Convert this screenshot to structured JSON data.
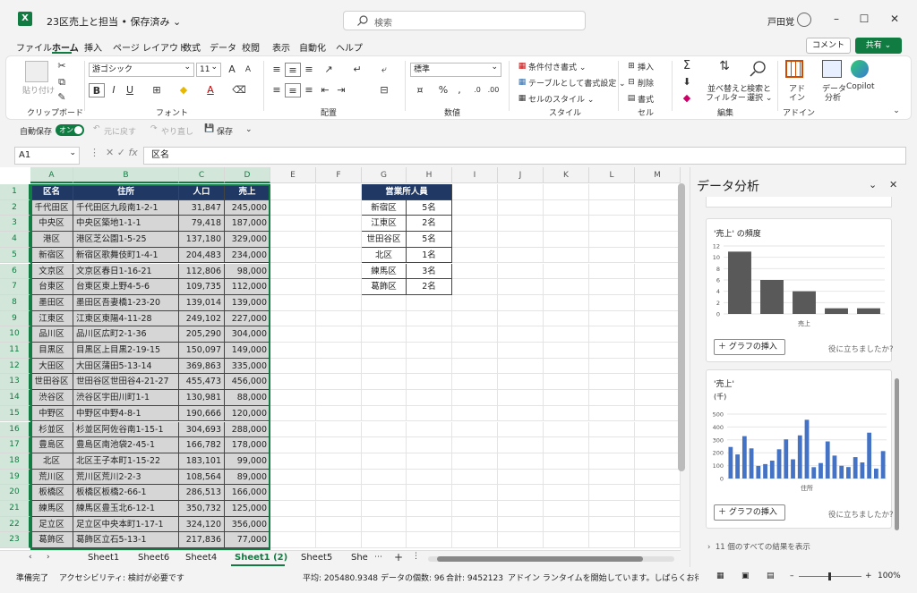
{
  "app": {
    "logo_letter": "X",
    "doc_title": "23区売上と担当 • 保存済み ⌄",
    "search_placeholder": "検索",
    "user_name": "戸田覚",
    "comment_label": "コメント",
    "share_label": "共有 ⌄"
  },
  "menu": [
    "ファイル",
    "ホーム",
    "挿入",
    "ページ レイアウト",
    "数式",
    "データ",
    "校閲",
    "表示",
    "自動化",
    "ヘルプ"
  ],
  "ribbon": {
    "paste": "貼り付け",
    "font_name": "游ゴシック",
    "font_size": "11",
    "number_format": "標準",
    "conditional": "条件付き書式 ⌄",
    "table_format": "テーブルとして書式設定 ⌄",
    "cell_style": "セルのスタイル ⌄",
    "insert": "挿入",
    "delete": "削除",
    "format": "書式",
    "sort_filter_1": "並べ替えと",
    "sort_filter_2": "フィルター ⌄",
    "find_1": "検索と",
    "find_2": "選択 ⌄",
    "addin_1": "アド",
    "addin_2": "イン",
    "analyze_1": "データ",
    "analyze_2": "分析",
    "copilot": "Copilot",
    "groups": [
      "クリップボード",
      "フォント",
      "配置",
      "数値",
      "スタイル",
      "セル",
      "編集",
      "アドイン"
    ]
  },
  "qat": {
    "autosave": "自動保存",
    "toggle": "オン",
    "undo": "元に戻す",
    "redo": "やり直し",
    "save": "保存"
  },
  "formula": {
    "namebox": "A1",
    "content": "区名"
  },
  "columns": [
    "A",
    "B",
    "C",
    "D",
    "E",
    "F",
    "G",
    "H",
    "I",
    "J",
    "K",
    "L",
    "M"
  ],
  "table": {
    "headers": [
      "区名",
      "住所",
      "人口",
      "売上"
    ],
    "rows": [
      [
        "千代田区",
        "千代田区九段南1-2-1",
        "31,847",
        "245,000"
      ],
      [
        "中央区",
        "中央区築地1-1-1",
        "79,418",
        "187,000"
      ],
      [
        "港区",
        "港区芝公園1-5-25",
        "137,180",
        "329,000"
      ],
      [
        "新宿区",
        "新宿区歌舞伎町1-4-1",
        "204,483",
        "234,000"
      ],
      [
        "文京区",
        "文京区春日1-16-21",
        "112,806",
        "98,000"
      ],
      [
        "台東区",
        "台東区東上野4-5-6",
        "109,735",
        "112,000"
      ],
      [
        "墨田区",
        "墨田区吾妻橋1-23-20",
        "139,014",
        "139,000"
      ],
      [
        "江東区",
        "江東区東陽4-11-28",
        "249,102",
        "227,000"
      ],
      [
        "品川区",
        "品川区広町2-1-36",
        "205,290",
        "304,000"
      ],
      [
        "目黒区",
        "目黒区上目黒2-19-15",
        "150,097",
        "149,000"
      ],
      [
        "大田区",
        "大田区蒲田5-13-14",
        "369,863",
        "335,000"
      ],
      [
        "世田谷区",
        "世田谷区世田谷4-21-27",
        "455,473",
        "456,000"
      ],
      [
        "渋谷区",
        "渋谷区宇田川町1-1",
        "130,981",
        "88,000"
      ],
      [
        "中野区",
        "中野区中野4-8-1",
        "190,666",
        "120,000"
      ],
      [
        "杉並区",
        "杉並区阿佐谷南1-15-1",
        "304,693",
        "288,000"
      ],
      [
        "豊島区",
        "豊島区南池袋2-45-1",
        "166,782",
        "178,000"
      ],
      [
        "北区",
        "北区王子本町1-15-22",
        "183,101",
        "99,000"
      ],
      [
        "荒川区",
        "荒川区荒川2-2-3",
        "108,564",
        "89,000"
      ],
      [
        "板橋区",
        "板橋区板橋2-66-1",
        "286,513",
        "166,000"
      ],
      [
        "練馬区",
        "練馬区豊玉北6-12-1",
        "350,732",
        "125,000"
      ],
      [
        "足立区",
        "足立区中央本町1-17-1",
        "324,120",
        "356,000"
      ],
      [
        "葛飾区",
        "葛飾区立石5-13-1",
        "217,836",
        "77,000"
      ]
    ]
  },
  "staff": {
    "header": "営業所人員",
    "rows": [
      [
        "新宿区",
        "5名"
      ],
      [
        "江東区",
        "2名"
      ],
      [
        "世田谷区",
        "5名"
      ],
      [
        "北区",
        "1名"
      ],
      [
        "練馬区",
        "3名"
      ],
      [
        "葛飾区",
        "2名"
      ]
    ]
  },
  "sheets": [
    "Sheet1",
    "Sheet6",
    "Sheet4",
    "Sheet1 (2)",
    "Sheet5",
    "She"
  ],
  "active_sheet_index": 3,
  "status": {
    "ready": "準備完了",
    "accessibility": "アクセシビリティ: 検討が必要です",
    "average": "平均: 205480.9348",
    "count": "データの個数: 96",
    "sum": "合計: 9452123",
    "addin_msg": "アドイン ランタイムを開始しています。しばらくお待ちください...",
    "zoom": "100%"
  },
  "pane": {
    "title": "データ分析",
    "card1_title": "'売上' の頻度",
    "card2_title": "'売上'",
    "card2_unit": "(千)",
    "insert_chart": "グラフの挿入",
    "helpful": "役に立ちましたか?",
    "show_all": "11 個のすべての結果を表示"
  },
  "chart_data": [
    {
      "type": "bar",
      "title": "'売上' の頻度",
      "xlabel": "売上",
      "ylim": [
        0,
        12
      ],
      "yticks": [
        0,
        2,
        4,
        6,
        8,
        10,
        12
      ],
      "values": [
        11,
        6,
        4,
        1,
        1
      ],
      "color": "#595959"
    },
    {
      "type": "bar",
      "title": "'売上'",
      "ylabel": "(千)",
      "xlabel": "住所",
      "ylim": [
        0,
        500
      ],
      "yticks": [
        0,
        100,
        200,
        300,
        400,
        500
      ],
      "values": [
        245,
        187,
        329,
        234,
        98,
        112,
        139,
        227,
        304,
        149,
        335,
        456,
        88,
        120,
        288,
        178,
        99,
        89,
        166,
        125,
        356,
        77,
        213
      ],
      "color": "#4472c4"
    }
  ]
}
